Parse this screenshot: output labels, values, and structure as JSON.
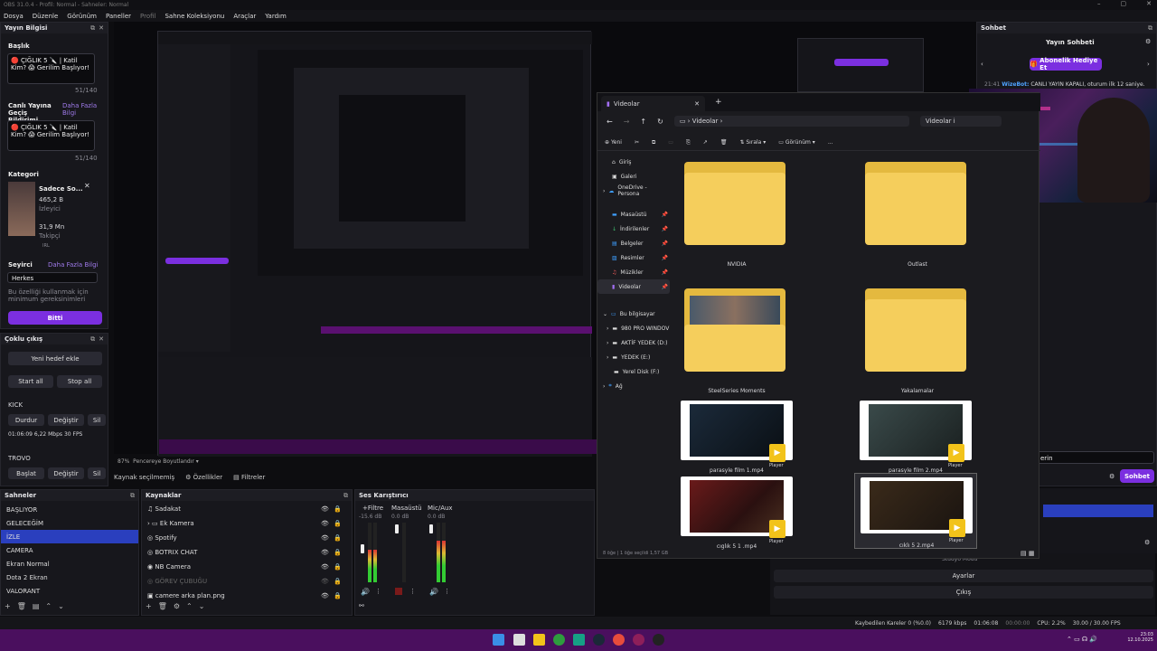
{
  "titlebar": {
    "text": "OBS 31.0.4 - Profil: Normal - Sahneler: Normal"
  },
  "menu": [
    "Dosya",
    "Düzenle",
    "Görünüm",
    "Paneller",
    "Profil",
    "Sahne Koleksiyonu",
    "Araçlar",
    "Yardım"
  ],
  "stream_info": {
    "dock_title": "Yayın Bilgisi",
    "title_label": "Başlık",
    "title_value": "🔴 ÇIĞLIK 5 🔪 | Katil Kim? 😱 Gerilim Başlıyor!",
    "title_count": "51/140",
    "notif_label": "Canlı Yayına Geçiş Bildirimi",
    "notif_link": "Daha Fazla Bilgi",
    "notif_value": "🔴 ÇIĞLIK 5 🔪 | Katil Kim? 😱 Gerilim Başlıyor!",
    "notif_count": "51/140",
    "category_label": "Kategori",
    "category_name": "Sadece So...",
    "category_viewers": "465,2 B",
    "category_viewers_label": "İzleyici",
    "category_followers": "31,9 Mn",
    "category_followers_label": "Takipçi",
    "category_tag": "IRL",
    "rating_label": "Seyirci",
    "rating_link": "Daha Fazla Bilgi",
    "rating_placeholder": "Herkes",
    "rating_hint": "Bu özelliği kullanmak için minimum gereksinimleri",
    "done_button": "Bitti"
  },
  "multistream": {
    "dock_title": "Çoklu çıkış",
    "new_target": "Yeni hedef ekle",
    "start_all": "Start all",
    "stop_all": "Stop all",
    "kick_label": "KICK",
    "kick_stop": "Durdur",
    "kick_change": "Değiştir",
    "kick_extra": "Sil",
    "kick_stats": "01:06:09  6,22 Mbps  30 FPS",
    "trovo_label": "TROVO",
    "trovo_start": "Başlat",
    "trovo_change": "Değiştir",
    "trovo_extra": "Sil"
  },
  "preview_footer": {
    "zoom": "87%",
    "scale_label": "Pencereye Boyutlandır"
  },
  "source_toolbar": {
    "no_source": "Kaynak seçilmemiş",
    "props": "Özellikler",
    "filters": "Filtreler"
  },
  "scenes": {
    "dock_title": "Sahneler",
    "items": [
      "BAŞLIYOR",
      "GELECEĞİM",
      "İZLE",
      "CAMERA",
      "Ekran Normal",
      "Dota 2 Ekran",
      "VALORANT"
    ],
    "selected_index": 2
  },
  "sources": {
    "dock_title": "Kaynaklar",
    "items": [
      "Sadakat",
      "Ek Kamera",
      "Spotify",
      "BOTRIX CHAT",
      "NB Camera",
      "GÖREV ÇUBUĞU",
      "camere arka plan.png"
    ]
  },
  "mixer": {
    "dock_title": "Ses Karıştırıcı",
    "channels": [
      {
        "name": "+Filtre",
        "db": "-15.6 dB",
        "level": 0.55
      },
      {
        "name": "Masaüstü",
        "db": "0.0 dB",
        "level": 0.0
      },
      {
        "name": "Mic/Aux",
        "db": "0.0 dB",
        "level": 0.7
      }
    ]
  },
  "controls": {
    "settings": "Ayarlar",
    "exit": "Çıkış",
    "studio": "Stüdyo Modu"
  },
  "statusbar": {
    "dropped": "Kaybedilen Kareler 0 (%0.0)",
    "bitrate": "6179 kbps",
    "rec_time": "01:06:08",
    "stream_time": "00:00:00",
    "cpu": "CPU: 2.2%",
    "fps": "30.00 / 30.00 FPS"
  },
  "chat": {
    "dock_title": "Sohbet",
    "header": "Yayın Sohbeti",
    "gift_button": "Abonelik Hediye Et",
    "message_time": "21:41",
    "message_user": "WizeBot:",
    "message_text": "CANLI YAYIN KAPALI, oturum ilk 12 saniye.",
    "send_button": "Sohbet",
    "input_placeholder": "erin"
  },
  "explorer": {
    "tab_title": "Videolar",
    "breadcrumb": "Videolar",
    "search_hint": "Videolar i",
    "toolbar": {
      "new": "Yeni",
      "sort": "Sırala",
      "view": "Görünüm",
      "more": "..."
    },
    "nav": [
      {
        "label": "Giriş",
        "icon": "home-icon"
      },
      {
        "label": "Galeri",
        "icon": "gallery-icon"
      },
      {
        "label": "OneDrive - Persona",
        "icon": "cloud-icon"
      },
      {
        "label": "Masaüstü",
        "icon": "desktop-icon"
      },
      {
        "label": "İndirilenler",
        "icon": "download-icon"
      },
      {
        "label": "Belgeler",
        "icon": "documents-icon"
      },
      {
        "label": "Resimler",
        "icon": "pictures-icon"
      },
      {
        "label": "Müzikler",
        "icon": "music-icon"
      },
      {
        "label": "Videolar",
        "icon": "videos-icon"
      },
      {
        "label": "Bu bilgisayar",
        "icon": "pc-icon"
      },
      {
        "label": "980 PRO WINDOV",
        "icon": "drive-icon"
      },
      {
        "label": "AKTİF YEDEK (D:)",
        "icon": "drive-icon"
      },
      {
        "label": "YEDEK (E:)",
        "icon": "drive-icon"
      },
      {
        "label": "Yerel Disk (F:)",
        "icon": "drive-icon"
      },
      {
        "label": "Ağ",
        "icon": "network-icon"
      }
    ],
    "items": [
      {
        "name": "NVIDIA",
        "kind": "folder"
      },
      {
        "name": "Outlast",
        "kind": "folder"
      },
      {
        "name": "SteelSeries Moments",
        "kind": "folder-photo"
      },
      {
        "name": "Yakalamalar",
        "kind": "folder"
      },
      {
        "name": "parasyle film 1.mp4",
        "kind": "video"
      },
      {
        "name": "parasyle film 2.mp4",
        "kind": "video"
      },
      {
        "name": "cıglık 5 1 .mp4",
        "kind": "video"
      },
      {
        "name": "cıklı 5 2.mp4",
        "kind": "video"
      }
    ],
    "play_label": "Player",
    "status": "8 öğe   |   1 öğe seçildi  1,57 GB"
  },
  "taskbar": {
    "time": "23:03",
    "date": "12.10.2025"
  }
}
